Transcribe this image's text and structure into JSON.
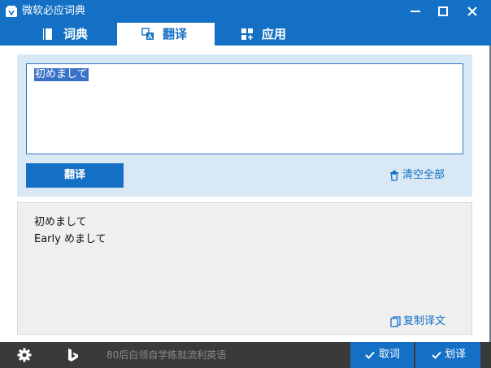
{
  "window": {
    "title": "微软必应词典",
    "accent_color": "#1470c4",
    "controls": [
      "minimize-icon",
      "maximize-icon",
      "close-icon"
    ]
  },
  "tabs": [
    {
      "label": "词典",
      "icon": "book-icon",
      "active": false
    },
    {
      "label": "翻译",
      "icon": "translate-icon",
      "active": true
    },
    {
      "label": "应用",
      "icon": "apps-icon",
      "active": false
    }
  ],
  "input": {
    "value": "初めまして",
    "selected": true
  },
  "actions": {
    "translate_label": "翻译",
    "clear_label": "清空全部",
    "clear_icon": "trash-icon"
  },
  "result": {
    "source_line": "初めまして",
    "translation_line": "Early めまして",
    "copy_label": "复制译文",
    "copy_icon": "copy-icon"
  },
  "statusbar": {
    "settings_icon": "gear-icon",
    "brand_icon": "bing-logo-icon",
    "slogan": "80后白领自学练就流利英语",
    "lookup_label": "取词",
    "select_translate_label": "划译"
  }
}
